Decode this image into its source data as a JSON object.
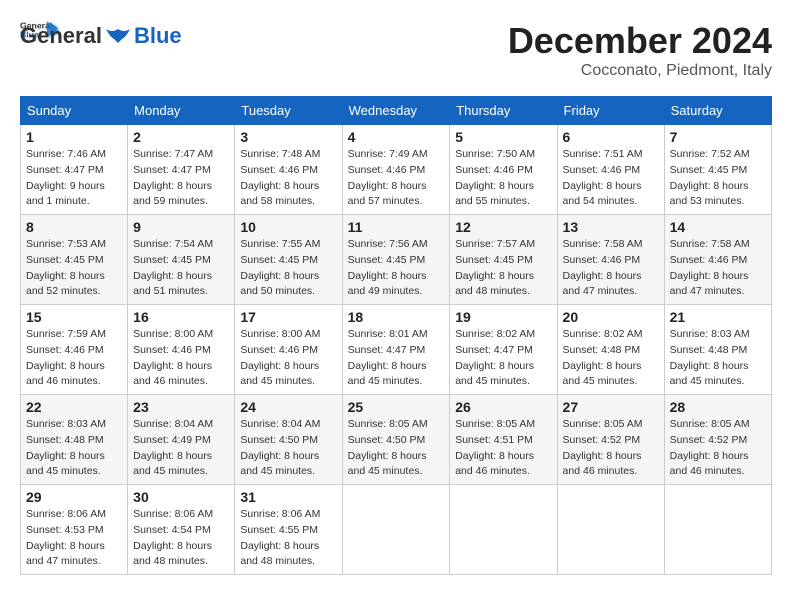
{
  "header": {
    "logo_general": "General",
    "logo_blue": "Blue",
    "month_title": "December 2024",
    "location": "Cocconato, Piedmont, Italy"
  },
  "calendar": {
    "headers": [
      "Sunday",
      "Monday",
      "Tuesday",
      "Wednesday",
      "Thursday",
      "Friday",
      "Saturday"
    ],
    "weeks": [
      [
        {
          "day": "1",
          "info": "Sunrise: 7:46 AM\nSunset: 4:47 PM\nDaylight: 9 hours\nand 1 minute."
        },
        {
          "day": "2",
          "info": "Sunrise: 7:47 AM\nSunset: 4:47 PM\nDaylight: 8 hours\nand 59 minutes."
        },
        {
          "day": "3",
          "info": "Sunrise: 7:48 AM\nSunset: 4:46 PM\nDaylight: 8 hours\nand 58 minutes."
        },
        {
          "day": "4",
          "info": "Sunrise: 7:49 AM\nSunset: 4:46 PM\nDaylight: 8 hours\nand 57 minutes."
        },
        {
          "day": "5",
          "info": "Sunrise: 7:50 AM\nSunset: 4:46 PM\nDaylight: 8 hours\nand 55 minutes."
        },
        {
          "day": "6",
          "info": "Sunrise: 7:51 AM\nSunset: 4:46 PM\nDaylight: 8 hours\nand 54 minutes."
        },
        {
          "day": "7",
          "info": "Sunrise: 7:52 AM\nSunset: 4:45 PM\nDaylight: 8 hours\nand 53 minutes."
        }
      ],
      [
        {
          "day": "8",
          "info": "Sunrise: 7:53 AM\nSunset: 4:45 PM\nDaylight: 8 hours\nand 52 minutes."
        },
        {
          "day": "9",
          "info": "Sunrise: 7:54 AM\nSunset: 4:45 PM\nDaylight: 8 hours\nand 51 minutes."
        },
        {
          "day": "10",
          "info": "Sunrise: 7:55 AM\nSunset: 4:45 PM\nDaylight: 8 hours\nand 50 minutes."
        },
        {
          "day": "11",
          "info": "Sunrise: 7:56 AM\nSunset: 4:45 PM\nDaylight: 8 hours\nand 49 minutes."
        },
        {
          "day": "12",
          "info": "Sunrise: 7:57 AM\nSunset: 4:45 PM\nDaylight: 8 hours\nand 48 minutes."
        },
        {
          "day": "13",
          "info": "Sunrise: 7:58 AM\nSunset: 4:46 PM\nDaylight: 8 hours\nand 47 minutes."
        },
        {
          "day": "14",
          "info": "Sunrise: 7:58 AM\nSunset: 4:46 PM\nDaylight: 8 hours\nand 47 minutes."
        }
      ],
      [
        {
          "day": "15",
          "info": "Sunrise: 7:59 AM\nSunset: 4:46 PM\nDaylight: 8 hours\nand 46 minutes."
        },
        {
          "day": "16",
          "info": "Sunrise: 8:00 AM\nSunset: 4:46 PM\nDaylight: 8 hours\nand 46 minutes."
        },
        {
          "day": "17",
          "info": "Sunrise: 8:00 AM\nSunset: 4:46 PM\nDaylight: 8 hours\nand 45 minutes."
        },
        {
          "day": "18",
          "info": "Sunrise: 8:01 AM\nSunset: 4:47 PM\nDaylight: 8 hours\nand 45 minutes."
        },
        {
          "day": "19",
          "info": "Sunrise: 8:02 AM\nSunset: 4:47 PM\nDaylight: 8 hours\nand 45 minutes."
        },
        {
          "day": "20",
          "info": "Sunrise: 8:02 AM\nSunset: 4:48 PM\nDaylight: 8 hours\nand 45 minutes."
        },
        {
          "day": "21",
          "info": "Sunrise: 8:03 AM\nSunset: 4:48 PM\nDaylight: 8 hours\nand 45 minutes."
        }
      ],
      [
        {
          "day": "22",
          "info": "Sunrise: 8:03 AM\nSunset: 4:48 PM\nDaylight: 8 hours\nand 45 minutes."
        },
        {
          "day": "23",
          "info": "Sunrise: 8:04 AM\nSunset: 4:49 PM\nDaylight: 8 hours\nand 45 minutes."
        },
        {
          "day": "24",
          "info": "Sunrise: 8:04 AM\nSunset: 4:50 PM\nDaylight: 8 hours\nand 45 minutes."
        },
        {
          "day": "25",
          "info": "Sunrise: 8:05 AM\nSunset: 4:50 PM\nDaylight: 8 hours\nand 45 minutes."
        },
        {
          "day": "26",
          "info": "Sunrise: 8:05 AM\nSunset: 4:51 PM\nDaylight: 8 hours\nand 46 minutes."
        },
        {
          "day": "27",
          "info": "Sunrise: 8:05 AM\nSunset: 4:52 PM\nDaylight: 8 hours\nand 46 minutes."
        },
        {
          "day": "28",
          "info": "Sunrise: 8:05 AM\nSunset: 4:52 PM\nDaylight: 8 hours\nand 46 minutes."
        }
      ],
      [
        {
          "day": "29",
          "info": "Sunrise: 8:06 AM\nSunset: 4:53 PM\nDaylight: 8 hours\nand 47 minutes."
        },
        {
          "day": "30",
          "info": "Sunrise: 8:06 AM\nSunset: 4:54 PM\nDaylight: 8 hours\nand 48 minutes."
        },
        {
          "day": "31",
          "info": "Sunrise: 8:06 AM\nSunset: 4:55 PM\nDaylight: 8 hours\nand 48 minutes."
        },
        {
          "day": "",
          "info": ""
        },
        {
          "day": "",
          "info": ""
        },
        {
          "day": "",
          "info": ""
        },
        {
          "day": "",
          "info": ""
        }
      ]
    ]
  }
}
